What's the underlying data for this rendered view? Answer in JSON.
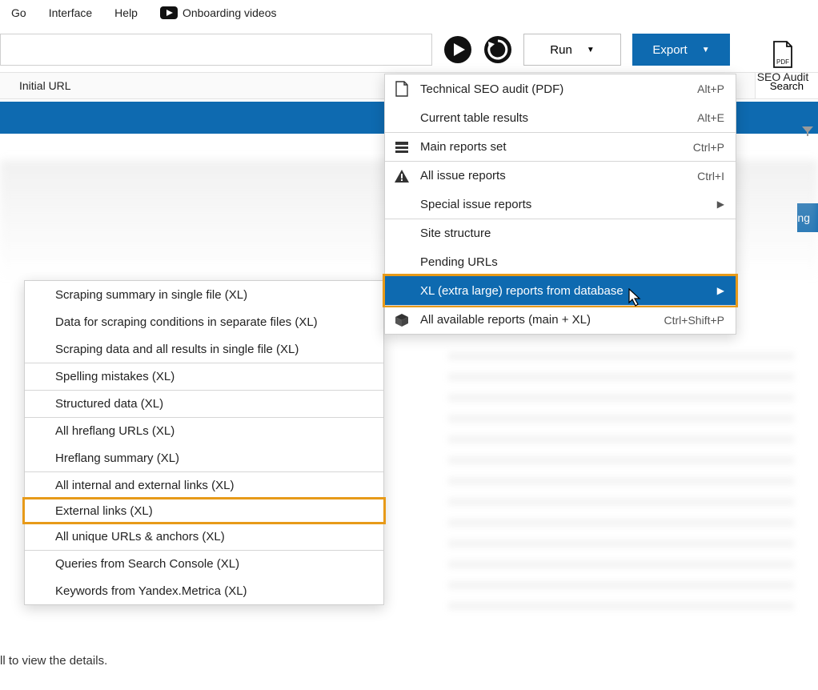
{
  "menubar": {
    "go": "Go",
    "interface": "Interface",
    "help": "Help",
    "onboarding": "Onboarding videos"
  },
  "toolbar": {
    "run_label": "Run",
    "export_label": "Export"
  },
  "seo_audit": {
    "label": "SEO Audit"
  },
  "columns": {
    "initial_url": "Initial URL"
  },
  "search": {
    "label": "Search"
  },
  "right_tab": {
    "fragment": "ng"
  },
  "export_menu": [
    {
      "icon": "pdf",
      "label": "Technical SEO audit (PDF)",
      "shortcut": "Alt+P"
    },
    {
      "icon": "",
      "label": "Current table results",
      "shortcut": "Alt+E"
    },
    {
      "sep": true,
      "icon": "stack",
      "label": "Main reports set",
      "shortcut": "Ctrl+P"
    },
    {
      "sep": true,
      "icon": "warn",
      "label": "All issue reports",
      "shortcut": "Ctrl+I"
    },
    {
      "icon": "",
      "label": "Special issue reports",
      "shortcut": "",
      "submenu": true
    },
    {
      "sep": true,
      "icon": "",
      "label": "Site structure",
      "shortcut": ""
    },
    {
      "icon": "",
      "label": "Pending URLs",
      "shortcut": ""
    },
    {
      "icon": "",
      "label": "XL (extra large) reports from database",
      "shortcut": "",
      "submenu": true,
      "highlight": true
    },
    {
      "sep": true,
      "icon": "cube",
      "label": "All available reports (main + XL)",
      "shortcut": "Ctrl+Shift+P"
    }
  ],
  "xl_submenu_groups": [
    [
      "Scraping summary in single file (XL)",
      "Data for scraping conditions in separate files (XL)",
      "Scraping data and all results in single file (XL)"
    ],
    [
      "Spelling mistakes (XL)"
    ],
    [
      "Structured data (XL)"
    ],
    [
      "All hreflang URLs (XL)",
      "Hreflang summary (XL)"
    ],
    [
      "All internal and external links (XL)",
      "External links (XL)",
      "All unique URLs & anchors (XL)"
    ],
    [
      "Queries from Search Console (XL)",
      "Keywords from Yandex.Metrica (XL)"
    ]
  ],
  "xl_highlighted": "External links (XL)",
  "footer_text": "ll to view the details."
}
